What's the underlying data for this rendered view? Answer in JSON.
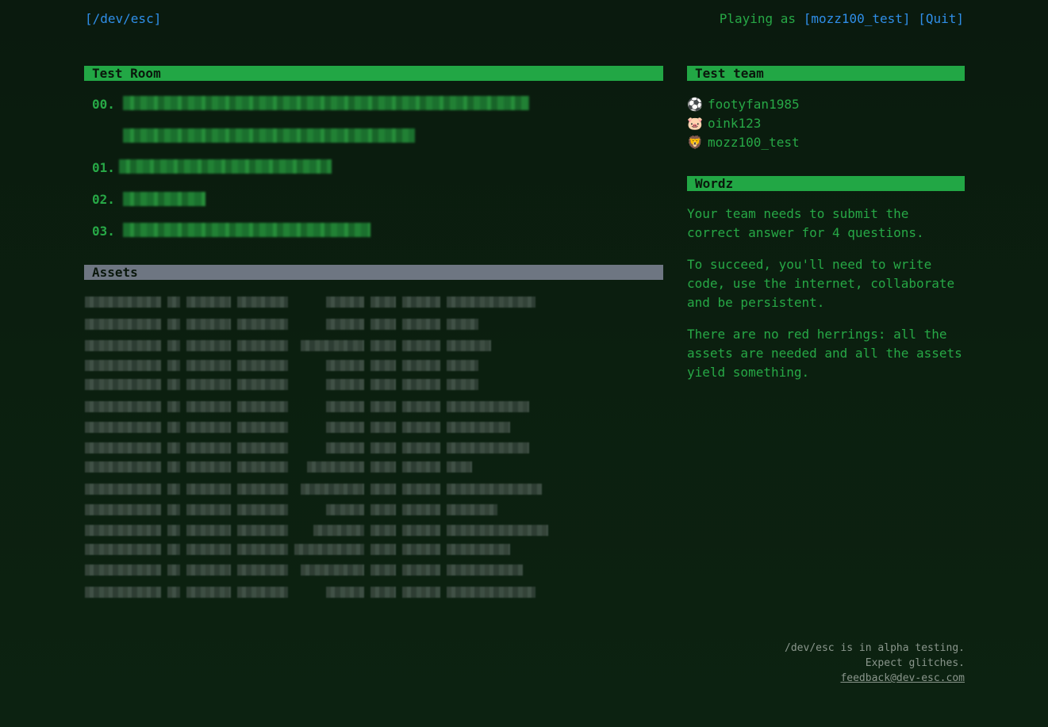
{
  "nav": {
    "home_link": "[/dev/esc]",
    "playing_as_label": "Playing as ",
    "username_link": "[mozz100_test]",
    "quit_link": "[Quit]"
  },
  "room": {
    "title": "Test Room",
    "questions": [
      {
        "number": "00."
      },
      {
        "number": "01."
      },
      {
        "number": "02."
      },
      {
        "number": "03."
      }
    ]
  },
  "assets": {
    "title": "Assets"
  },
  "team": {
    "title": "Test team",
    "members": [
      {
        "emoji": "⚽",
        "name": "footyfan1985"
      },
      {
        "emoji": "🐷",
        "name": "oink123"
      },
      {
        "emoji": "🦁",
        "name": "mozz100_test"
      }
    ]
  },
  "wordz": {
    "title": "Wordz",
    "paragraphs": [
      "Your team needs to submit the correct answer for 4 questions.",
      "To succeed, you'll need to write code, use the internet, collaborate and be persistent.",
      "There are no red herrings: all the assets are needed and all the assets yield something."
    ]
  },
  "footer": {
    "line1": "/dev/esc is in alpha testing.",
    "line2": "Expect glitches.",
    "email": "feedback@dev-esc.com"
  },
  "colors": {
    "background": "#0b1f0f",
    "accent_green": "#22a745",
    "text_green": "#27a846",
    "link_blue": "#2f8ee8",
    "assets_header_gray": "#6e7682"
  }
}
